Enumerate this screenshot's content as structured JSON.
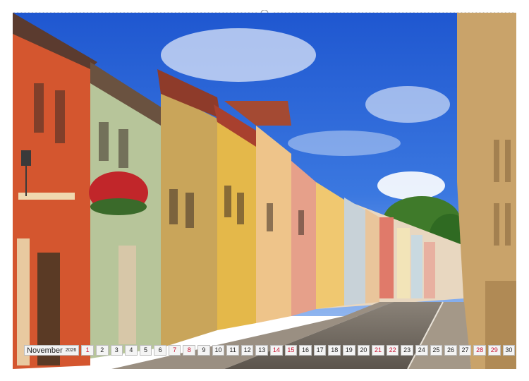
{
  "calendar": {
    "month": "November",
    "year": "2026",
    "days": [
      "1",
      "2",
      "3",
      "4",
      "5",
      "6",
      "7",
      "8",
      "9",
      "10",
      "11",
      "12",
      "13",
      "14",
      "15",
      "16",
      "17",
      "18",
      "19",
      "20",
      "21",
      "22",
      "23",
      "24",
      "25",
      "26",
      "27",
      "28",
      "29",
      "30"
    ],
    "weekend_days": [
      "1",
      "7",
      "8",
      "14",
      "15",
      "21",
      "22",
      "28",
      "29"
    ],
    "weekend_color": "#c8102e"
  },
  "photo": {
    "subject": "street-of-colorful-old-houses",
    "sky_color": "#2a66d6"
  }
}
